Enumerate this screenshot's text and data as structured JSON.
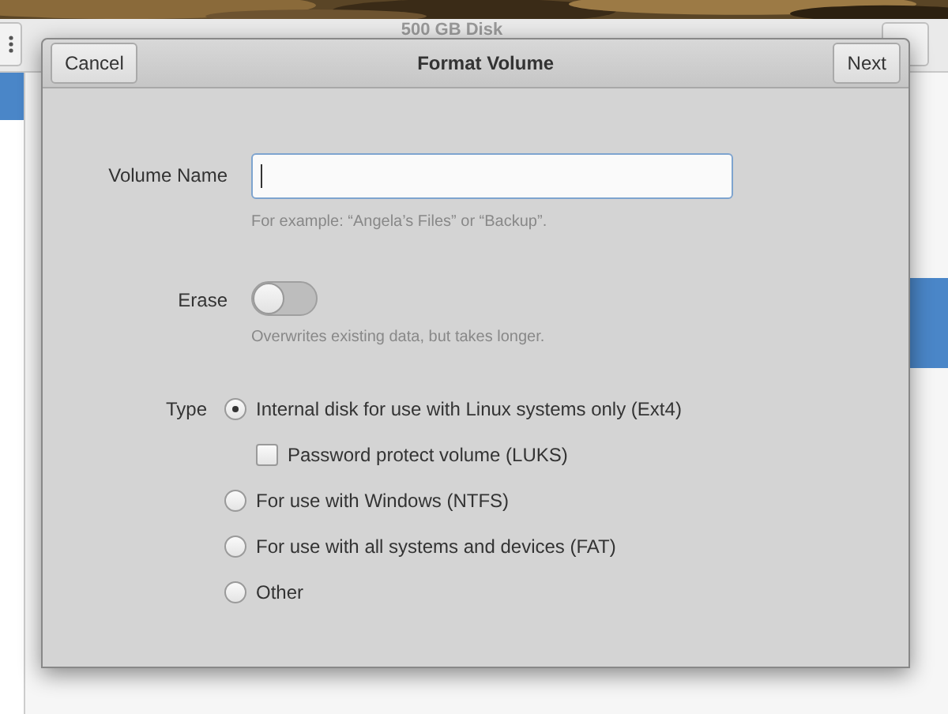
{
  "background_window": {
    "title": "500 GB Disk"
  },
  "dialog": {
    "title": "Format Volume",
    "cancel_button": "Cancel",
    "next_button": "Next"
  },
  "volume_name": {
    "label": "Volume Name",
    "hint": "For example: “Angela’s Files” or “Backup”."
  },
  "erase": {
    "label": "Erase",
    "on": false,
    "hint": "Overwrites existing data, but takes longer."
  },
  "type": {
    "label": "Type",
    "options": [
      {
        "kind": "radio",
        "label": "Internal disk for use with Linux systems only (Ext4)",
        "selected": true
      },
      {
        "kind": "checkbox",
        "label": "Password protect volume (LUKS)",
        "checked": false
      },
      {
        "kind": "radio",
        "label": "For use with Windows (NTFS)",
        "selected": false
      },
      {
        "kind": "radio",
        "label": "For use with all systems and devices (FAT)",
        "selected": false
      },
      {
        "kind": "radio",
        "label": "Other",
        "selected": false
      }
    ]
  }
}
